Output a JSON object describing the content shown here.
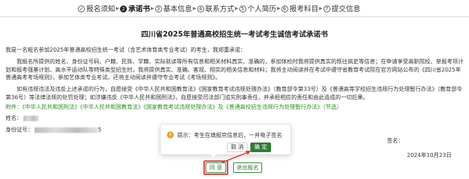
{
  "steps": [
    {
      "num": "✓",
      "label": "报名须知",
      "state": "done"
    },
    {
      "num": "2",
      "label": "承诺书",
      "state": "current"
    },
    {
      "num": "3",
      "label": "基本信息",
      "state": "todo"
    },
    {
      "num": "4",
      "label": "联系方式",
      "state": "todo"
    },
    {
      "num": "5",
      "label": "个人简历",
      "state": "todo"
    },
    {
      "num": "6",
      "label": "报考科目",
      "state": "todo"
    },
    {
      "num": "7",
      "label": "提交信息",
      "state": "todo"
    }
  ],
  "document": {
    "title": "四川省2025年普通高校招生统一考试考生诚信考试承诺书",
    "para1": "我是一名报名参加2025年普通高校招生统一考试（含艺术体育类专业考试）的考生，我郑重承诺：",
    "para2": "我报名所提供的姓名、身份证号码、户籍、民族、学籍、实际就读等所有信息和相关材料真实、准确的，参加体检时我将提供真实的既往病史等信息；在申请享受高职院校、单报考项计划和报考强基计划、高水平运动队等特殊类型招生时，我将提供真实、准确、客观、翔实的相关信息和材料；我将主动阅读并在考试中遵守省教育考试院在官方网站公布的《四川省2025年普通高考考场规则》，参加艺体类专业考试，还将主动阅读并遵守专业考试《考场规则》。",
    "para3": "如有违规违法及违反上述承诺的行为，自愿接受《中华人民共和国教育法》《国家教育考试违规处理办法》（教育部令第33号）及《普通高等学校招生违规行为处理暂行办法》（教育部令第36号）等法律法规的处罚处理；如涉嫌违反《中华人民共和国刑法》，自愿接受司法部门追究刑事责任，并承担相应的责任和由此造成的一切后果。",
    "para4": "附件：《中华人民共和国刑法》《中华人民共和国教育法》《国家教育考试违规处理办法》及《普通高校招生违规行为处理暂行办法》（节选）",
    "name_label": "姓名：",
    "id_label": "身份证号：",
    "id_visible_tail": "5",
    "sign_label": "签名：",
    "date": "2024年10月23日"
  },
  "popconfirm": {
    "icon": "warning-icon",
    "message": "提示：考生在填报完信息后，一并电子签名",
    "cancel_label": "取 消",
    "ok_label": "确 定"
  },
  "actions": {
    "agree_label": "同 意",
    "exit_label": "退出报名"
  },
  "colors": {
    "primary": "#2e7d32",
    "attachment_text": "#2e8b22",
    "warning": "#f0a020",
    "annotation": "#e53935"
  }
}
